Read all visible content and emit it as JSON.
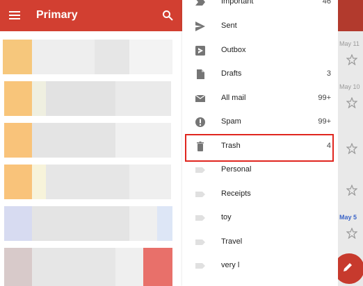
{
  "inbox": {
    "title": "Primary",
    "icons": [
      "menu-icon",
      "search-icon"
    ],
    "accent": "#d23f31"
  },
  "drawer": {
    "items": [
      {
        "name": "important",
        "label": "Important",
        "count": "46",
        "icon": "important-icon"
      },
      {
        "name": "sent",
        "label": "Sent",
        "count": "",
        "icon": "send-icon"
      },
      {
        "name": "outbox",
        "label": "Outbox",
        "count": "",
        "icon": "outbox-icon"
      },
      {
        "name": "drafts",
        "label": "Drafts",
        "count": "3",
        "icon": "draft-icon"
      },
      {
        "name": "all-mail",
        "label": "All mail",
        "count": "99+",
        "icon": "mail-icon"
      },
      {
        "name": "spam",
        "label": "Spam",
        "count": "99+",
        "icon": "spam-icon"
      },
      {
        "name": "trash",
        "label": "Trash",
        "count": "4",
        "icon": "trash-icon"
      },
      {
        "name": "personal",
        "label": "Personal",
        "count": "",
        "icon": "label-icon"
      },
      {
        "name": "receipts",
        "label": "Receipts",
        "count": "",
        "icon": "label-icon"
      },
      {
        "name": "toy",
        "label": "toy",
        "count": "",
        "icon": "label-icon"
      },
      {
        "name": "travel",
        "label": "Travel",
        "count": "",
        "icon": "label-icon"
      },
      {
        "name": "very-l",
        "label": "very l",
        "count": "",
        "icon": "label-icon"
      }
    ],
    "highlight_color": "#e0251e"
  },
  "peek": {
    "dates": [
      "May 11",
      "May 10",
      "May 5"
    ],
    "fab_color": "#c73a2d"
  }
}
